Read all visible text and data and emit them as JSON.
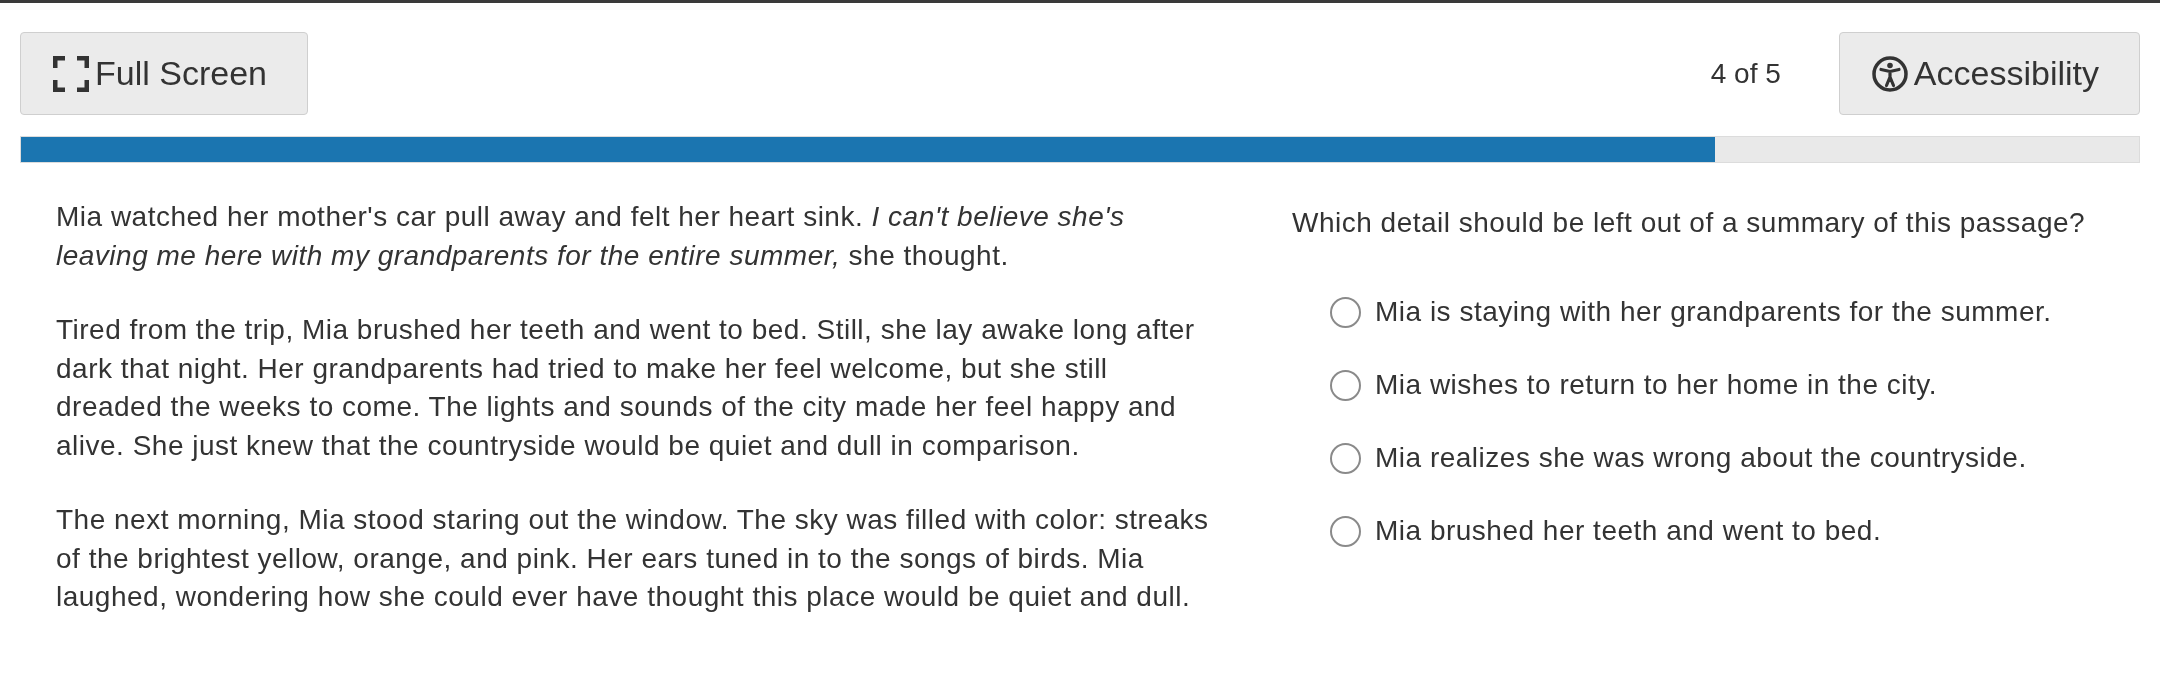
{
  "toolbar": {
    "full_screen_button": "Full Screen",
    "page_counter": "4 of 5",
    "accessibility_button": "Accessibility"
  },
  "progress": {
    "level": 0.8
  },
  "passage": {
    "paragraphs": [
      "Mia watched her mother's car pull away and felt her heart sink. *I can't believe she's leaving me here with my grandparents for the entire summer,* she thought.",
      "Tired from the trip, Mia brushed her teeth and went to bed. Still, she lay awake long after dark that night. Her grandparents had tried to make her feel welcome, but she still dreaded the weeks to come. The lights and sounds of the city made her feel happy and alive. She just knew that the countryside would be quiet and dull in comparison.",
      "The next morning, Mia stood staring out the window. The sky was filled with color: streaks of the brightest yellow, orange, and pink. Her ears tuned in to the songs of birds. Mia laughed, wondering how she could ever have thought this place would be quiet and dull."
    ]
  },
  "question": {
    "prompt": "Which detail should be left out of a summary of this passage?",
    "options": [
      {
        "label": "Mia is staying with her grandparents for the summer.",
        "selected": false
      },
      {
        "label": "Mia wishes to return to her home in the city.",
        "selected": false
      },
      {
        "label": "Mia realizes she was wrong about the countryside.",
        "selected": false
      },
      {
        "label": "Mia brushed her teeth and went to bed.",
        "selected": false
      }
    ]
  }
}
